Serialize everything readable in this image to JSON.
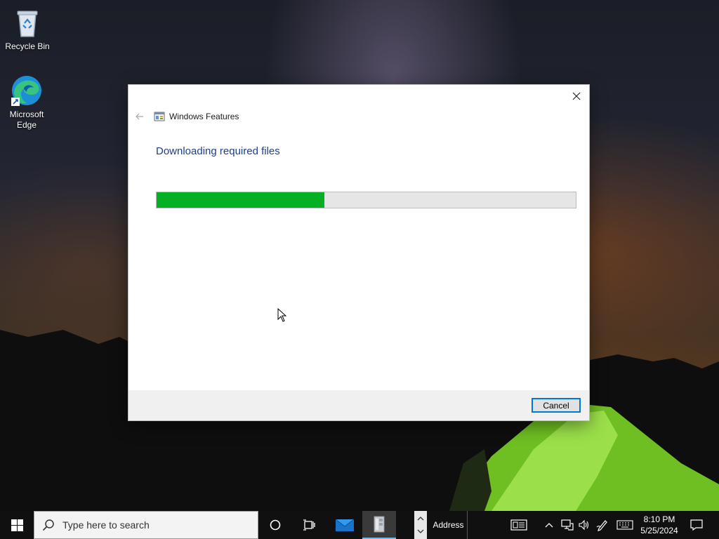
{
  "desktop": {
    "icons": [
      {
        "label": "Recycle Bin",
        "icon": "recycle-bin-icon"
      },
      {
        "label": "Microsoft Edge",
        "icon": "edge-icon"
      }
    ]
  },
  "dialog": {
    "title": "Windows Features",
    "title_icon": "windows-features-icon",
    "heading": "Downloading required files",
    "progress": 0.4,
    "cancel_label": "Cancel",
    "colors": {
      "heading": "#1e3f8c",
      "progress_fill": "#06b025",
      "progress_track": "#e6e6e6",
      "button_focus": "#0078d7"
    }
  },
  "taskbar": {
    "start_icon": "windows-start-icon",
    "search_placeholder": "Type here to search",
    "address_label": "Address",
    "clock_time": "8:10 PM",
    "clock_date": "5/25/2024",
    "tray_icons": [
      "news-icon",
      "chevron-up-icon",
      "network-icon",
      "volume-icon",
      "pen-icon",
      "keyboard-icon"
    ],
    "notification_icon": "notification-icon"
  }
}
